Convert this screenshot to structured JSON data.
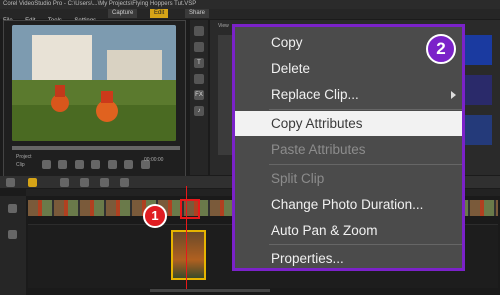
{
  "app": {
    "title": "Corel VideoStudio Pro - C:\\Users\\...\\My Projects\\Flying Hoppers Tut.VSP"
  },
  "menubar": {
    "items": [
      "File",
      "Edit",
      "Tools",
      "Settings"
    ]
  },
  "steps": {
    "items": [
      "Capture",
      "Edit",
      "Share"
    ],
    "active": "Edit"
  },
  "preview": {
    "project_label": "Project",
    "clip_label": "Clip",
    "timecode": "00:00:00"
  },
  "library": {
    "tab_label": "View"
  },
  "badges": {
    "one": "1",
    "two": "2"
  },
  "context_menu": {
    "items": [
      {
        "label": "Copy",
        "enabled": true
      },
      {
        "label": "Delete",
        "enabled": true
      },
      {
        "label": "Replace Clip...",
        "enabled": true,
        "submenu": true
      },
      {
        "label": "Copy Attributes",
        "enabled": true,
        "highlighted": true
      },
      {
        "label": "Paste Attributes",
        "enabled": false
      },
      {
        "label": "Split Clip",
        "enabled": false
      },
      {
        "label": "Change Photo Duration...",
        "enabled": true
      },
      {
        "label": "Auto Pan & Zoom",
        "enabled": true
      },
      {
        "label": "Properties...",
        "enabled": true
      }
    ]
  },
  "colors": {
    "menu_border": "#7b22c9",
    "highlight_box": "#e8181a",
    "badge_red": "#e01d22",
    "accent_tab": "#d6a417"
  }
}
